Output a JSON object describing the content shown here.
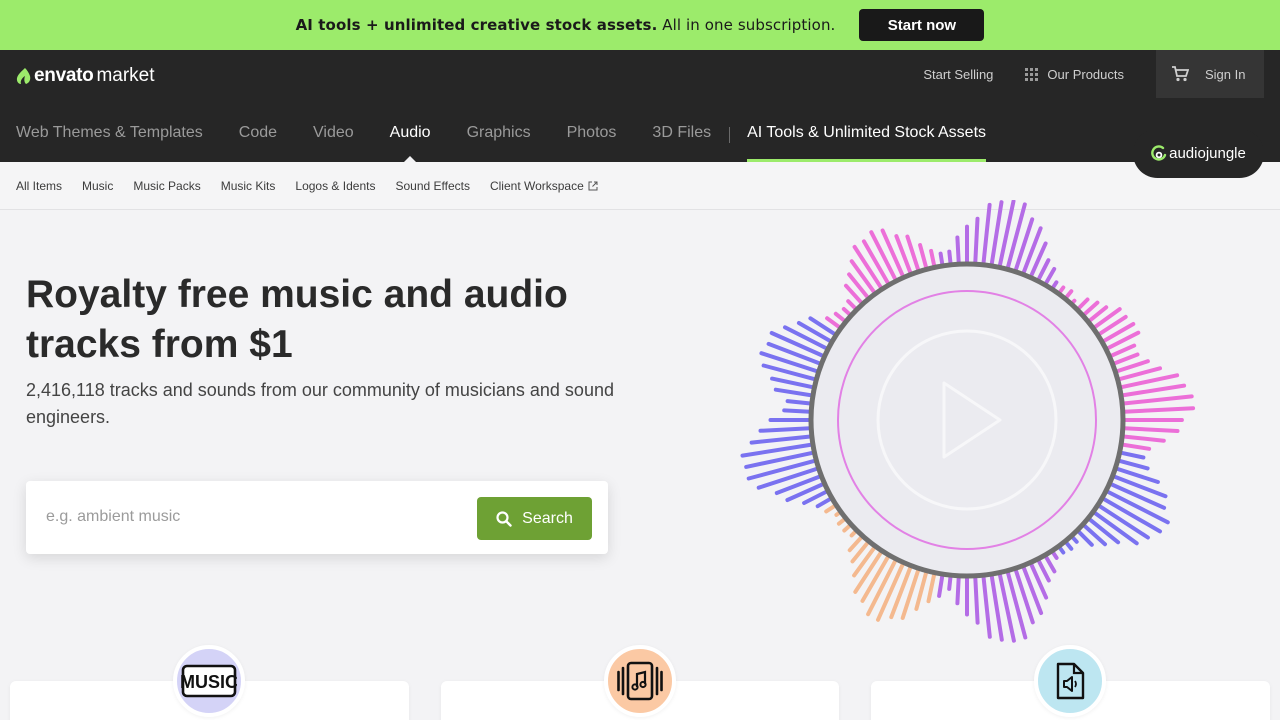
{
  "promo": {
    "text_bold": "AI tools + unlimited creative stock assets.",
    "text_rest": "All in one subscription.",
    "cta": "Start now",
    "bg_color": "#9ceb6b"
  },
  "header": {
    "logo_brand": "envato",
    "logo_market": "market",
    "start_selling": "Start Selling",
    "our_products": "Our Products",
    "sign_in": "Sign In",
    "categories": [
      {
        "label": "Web Themes & Templates"
      },
      {
        "label": "Code"
      },
      {
        "label": "Video"
      },
      {
        "label": "Audio"
      },
      {
        "label": "Graphics"
      },
      {
        "label": "Photos"
      },
      {
        "label": "3D Files"
      }
    ],
    "ai_link": "AI Tools & Unlimited Stock Assets",
    "active_category": "Audio",
    "site_badge": "audiojungle"
  },
  "subnav": {
    "items": [
      "All Items",
      "Music",
      "Music Packs",
      "Music Kits",
      "Logos & Idents",
      "Sound Effects",
      "Client Workspace"
    ]
  },
  "hero": {
    "title": "Royalty free music and audio tracks from $1",
    "subtitle": "2,416,118 tracks and sounds from our community of musicians and sound engineers.",
    "search_placeholder": "e.g. ambient music",
    "search_button": "Search"
  },
  "cards": [
    {
      "icon": "music-text-icon",
      "icon_label": "MUSIC",
      "bg": "#d4d3f7"
    },
    {
      "icon": "music-pack-icon",
      "bg": "#fbc9a4"
    },
    {
      "icon": "sound-effect-file-icon",
      "bg": "#bde6f1"
    }
  ],
  "colors": {
    "accent_green": "#6ea134",
    "header_bg": "#262626",
    "viz_purple": "#b46ce6",
    "viz_pink": "#ec6fd8",
    "viz_blue": "#7a72f0",
    "viz_peach": "#f4b98f"
  }
}
